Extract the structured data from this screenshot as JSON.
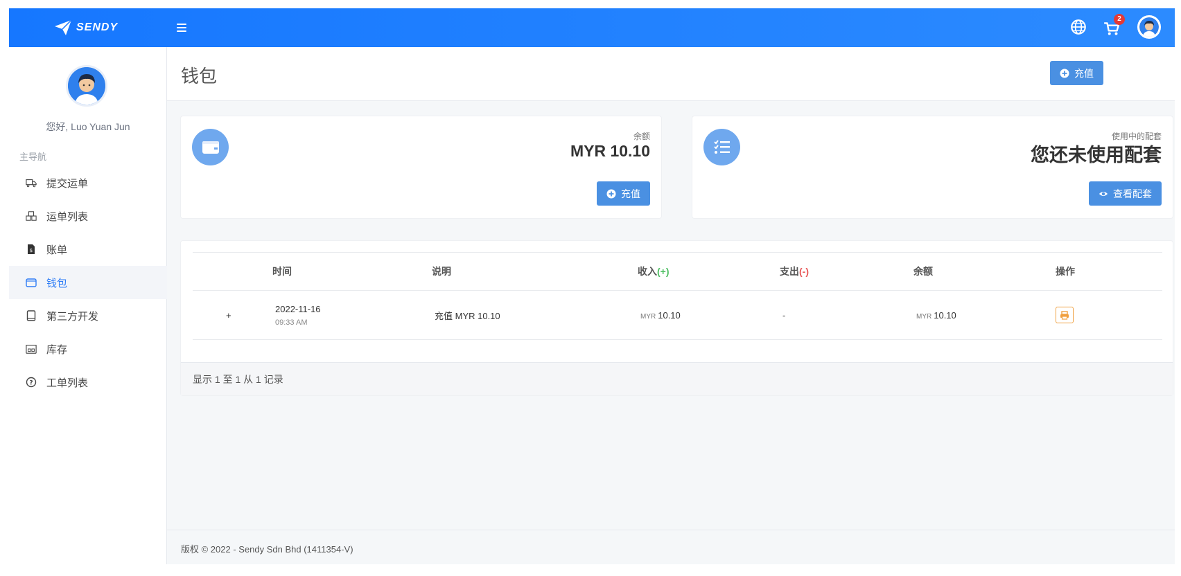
{
  "brand": {
    "name": "SENDY",
    "primary": "#1677ff",
    "accent": "#4a90e2"
  },
  "topbar": {
    "cart_count": "2",
    "icons": [
      "menu-icon",
      "globe-icon",
      "cart-icon",
      "user-avatar"
    ]
  },
  "sidebar": {
    "greeting": "您好, Luo Yuan Jun",
    "nav_title": "主导航",
    "items": [
      {
        "label": "提交运单",
        "icon": "truck-icon"
      },
      {
        "label": "运单列表",
        "icon": "boxes-icon"
      },
      {
        "label": "账单",
        "icon": "invoice-icon"
      },
      {
        "label": "钱包",
        "icon": "wallet-icon",
        "active": true
      },
      {
        "label": "第三方开发",
        "icon": "book-icon"
      },
      {
        "label": "库存",
        "icon": "warehouse-icon"
      },
      {
        "label": "工单列表",
        "icon": "question-icon"
      }
    ]
  },
  "page": {
    "title": "钱包",
    "top_button": "充值"
  },
  "balance_card": {
    "label": "余额",
    "value": "MYR 10.10",
    "button": "充值"
  },
  "package_card": {
    "label": "使用中的配套",
    "value": "您还未使用配套",
    "button": "查看配套"
  },
  "table": {
    "headers": {
      "time": "时间",
      "desc": "说明",
      "income": "收入",
      "income_sign": "(+)",
      "expense": "支出",
      "expense_sign": "(-)",
      "balance": "余额",
      "action": "操作"
    },
    "rows": [
      {
        "expand": "+",
        "date": "2022-11-16",
        "time": "09:33 AM",
        "desc": "充值 MYR 10.10",
        "income_cur": "MYR",
        "income": "10.10",
        "expense": "-",
        "balance_cur": "MYR",
        "balance": "10.10"
      }
    ],
    "summary": "显示 1 至 1 从 1 记录"
  },
  "footer": {
    "text": "版权 © 2022 - Sendy Sdn Bhd (1411354-V)"
  }
}
